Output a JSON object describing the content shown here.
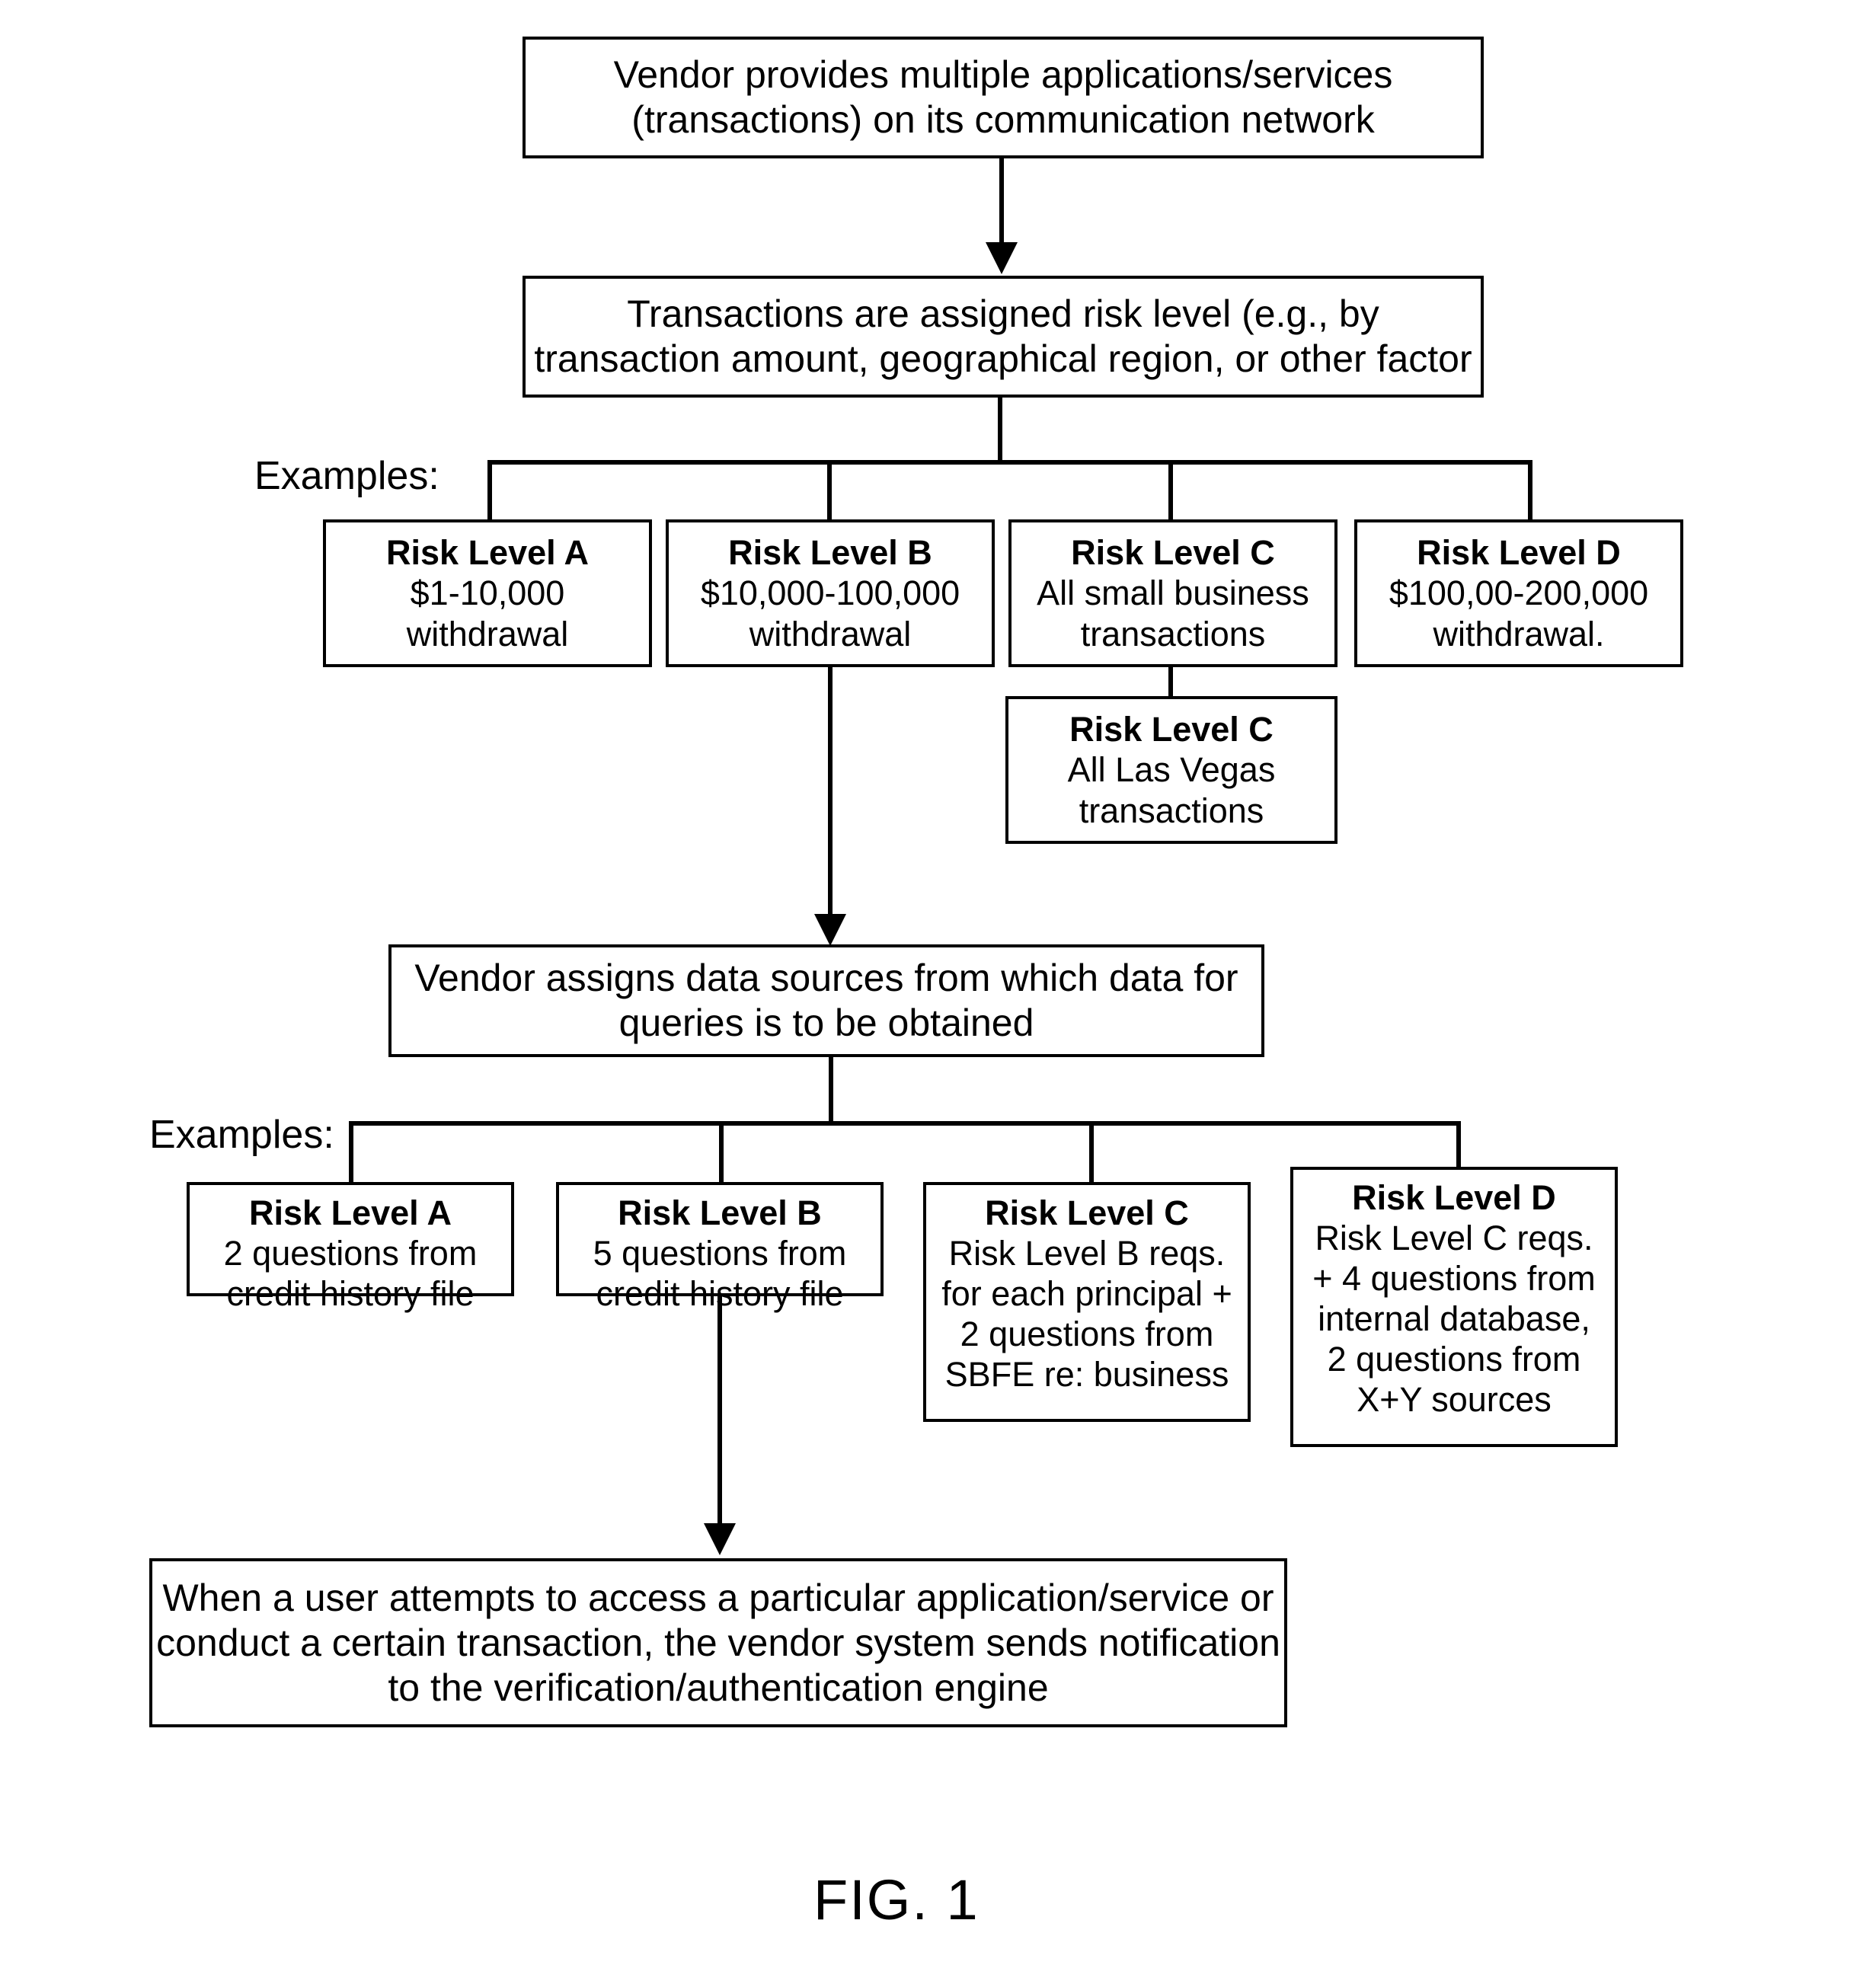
{
  "figure": {
    "caption": "FIG. 1",
    "examples_label_1": "Examples:",
    "examples_label_2": "Examples:"
  },
  "steps": {
    "step1": {
      "line1": "Vendor provides multiple applications/services",
      "line2": "(transactions) on its communication network"
    },
    "step2": {
      "line1": "Transactions are assigned risk level (e.g., by",
      "line2": "transaction amount, geographical region, or other factor"
    },
    "step3": {
      "line1": "Vendor assigns data sources from which data for",
      "line2": "queries is to be obtained"
    },
    "step4": {
      "line1": "When a user attempts to access a particular application/service or",
      "line2": "conduct a certain transaction, the vendor system sends notification",
      "line3": "to the verification/authentication engine"
    }
  },
  "risk_levels_row1": [
    {
      "title": "Risk Level A",
      "body": [
        "$1-10,000",
        "withdrawal"
      ]
    },
    {
      "title": "Risk Level B",
      "body": [
        "$10,000-100,000",
        "withdrawal"
      ]
    },
    {
      "title": "Risk Level C",
      "body": [
        "All small business",
        "transactions"
      ]
    },
    {
      "title": "Risk Level D",
      "body": [
        "$100,00-200,000",
        "withdrawal."
      ]
    }
  ],
  "risk_level_c_sub": {
    "title": "Risk Level C",
    "body": [
      "All Las Vegas",
      "transactions"
    ]
  },
  "risk_levels_row2": [
    {
      "title": "Risk Level A",
      "body": [
        "2 questions from",
        "credit history file"
      ]
    },
    {
      "title": "Risk Level B",
      "body": [
        "5 questions from",
        "credit history file"
      ]
    },
    {
      "title": "Risk Level C",
      "body": [
        "Risk Level B reqs.",
        "for each principal +",
        "2 questions from",
        "SBFE re: business"
      ]
    },
    {
      "title": "Risk Level D",
      "body": [
        "Risk Level C reqs.",
        "+ 4 questions from",
        "internal database,",
        "2 questions from",
        "X+Y sources"
      ]
    }
  ],
  "colors": {
    "stroke": "#000000",
    "background": "#ffffff"
  }
}
